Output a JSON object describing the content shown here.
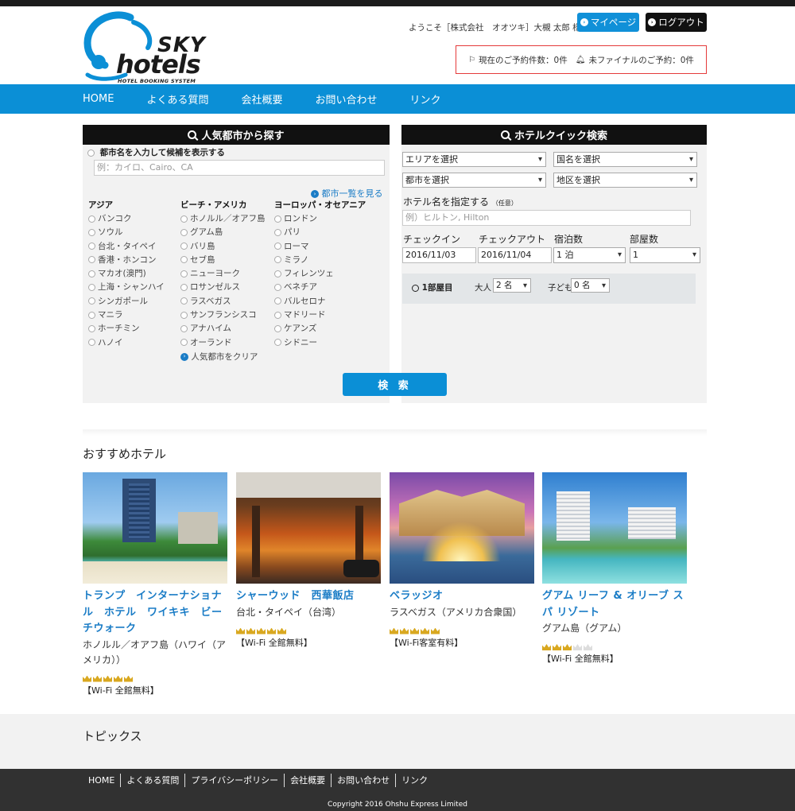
{
  "header": {
    "logo": {
      "word1": "SKY",
      "word2": "hotels",
      "tagline": "HOTEL BOOKING SYSTEM"
    },
    "welcome": "ようこそ［株式会社　オオツキ］大槻 太郎 様",
    "mypage_label": "マイページ",
    "logout_label": "ログアウト",
    "booking_count": "現在のご予約件数：0件",
    "unfinal_count": "未ファイナルのご予約：0件"
  },
  "nav": [
    "HOME",
    "よくある質問",
    "会社概要",
    "お問い合わせ",
    "リンク"
  ],
  "popular": {
    "title": "人気都市から探す",
    "radio_label": "都市名を入力して候補を表示する",
    "placeholder": "例：カイロ、Cairo、CA",
    "city_list_link": "都市一覧を見る",
    "clear_link": "人気都市をクリア",
    "columns": [
      {
        "title": "アジア",
        "cities": [
          "バンコク",
          "ソウル",
          "台北・タイペイ",
          "香港・ホンコン",
          "マカオ(澳門)",
          "上海・シャンハイ",
          "シンガポール",
          "マニラ",
          "ホーチミン",
          "ハノイ"
        ]
      },
      {
        "title": "ビーチ・アメリカ",
        "cities": [
          "ホノルル／オアフ島",
          "グアム島",
          "バリ島",
          "セブ島",
          "ニューヨーク",
          "ロサンゼルス",
          "ラスベガス",
          "サンフランシスコ",
          "アナハイム",
          "オーランド"
        ]
      },
      {
        "title": "ヨーロッパ・オセアニア",
        "cities": [
          "ロンドン",
          "パリ",
          "ローマ",
          "ミラノ",
          "フィレンツェ",
          "ベネチア",
          "バルセロナ",
          "マドリード",
          "ケアンズ",
          "シドニー"
        ]
      }
    ]
  },
  "quick": {
    "title": "ホテルクイック検索",
    "area": "エリアを選択",
    "country": "国名を選択",
    "city": "都市を選択",
    "district": "地区を選択",
    "hotel_label": "ホテル名を指定する",
    "optional": "（任意）",
    "hotel_placeholder": "例）ヒルトン, Hilton",
    "checkin_label": "チェックイン",
    "checkout_label": "チェックアウト",
    "nights_label": "宿泊数",
    "rooms_label": "部屋数",
    "checkin": "2016/11/03",
    "checkout": "2016/11/04",
    "nights": "1 泊",
    "rooms": "1",
    "room_label": "1部屋目",
    "adults_label": "大人",
    "adults": "2 名",
    "children_label": "子ども",
    "children": "0 名"
  },
  "search_label": "検 索",
  "recommended": {
    "title": "おすすめホテル",
    "hotels": [
      {
        "name": "トランプ　インターナショナル　ホテル　ワイキキ　ビーチウォーク",
        "location": "ホノルル／オアフ島（ハワイ（アメリカ））",
        "stars": 5,
        "wifi": "【Wi-Fi 全館無料】"
      },
      {
        "name": "シャーウッド　西華飯店",
        "location": "台北・タイペイ（台湾）",
        "stars": 5,
        "wifi": "【Wi-Fi 全館無料】"
      },
      {
        "name": "ベラッジオ",
        "location": "ラスベガス（アメリカ合衆国）",
        "stars": 5,
        "wifi": "【Wi-Fi客室有料】"
      },
      {
        "name": "グアム リーフ & オリーブ スパ リゾート",
        "location": "グアム島（グアム）",
        "stars": 3,
        "wifi": "【Wi-Fi 全館無料】"
      }
    ]
  },
  "topics_title": "トピックス",
  "footer": {
    "links": [
      "HOME",
      "よくある質問",
      "プライバシーポリシー",
      "会社概要",
      "お問い合わせ",
      "リンク"
    ],
    "copyright": "Copyright 2016 Ohshu Express Limited"
  },
  "colors": {
    "brand_blue": "#0b8fd6",
    "dark": "#111111",
    "alert_red": "#e53b3b",
    "crown_gold": "#d9a820"
  }
}
